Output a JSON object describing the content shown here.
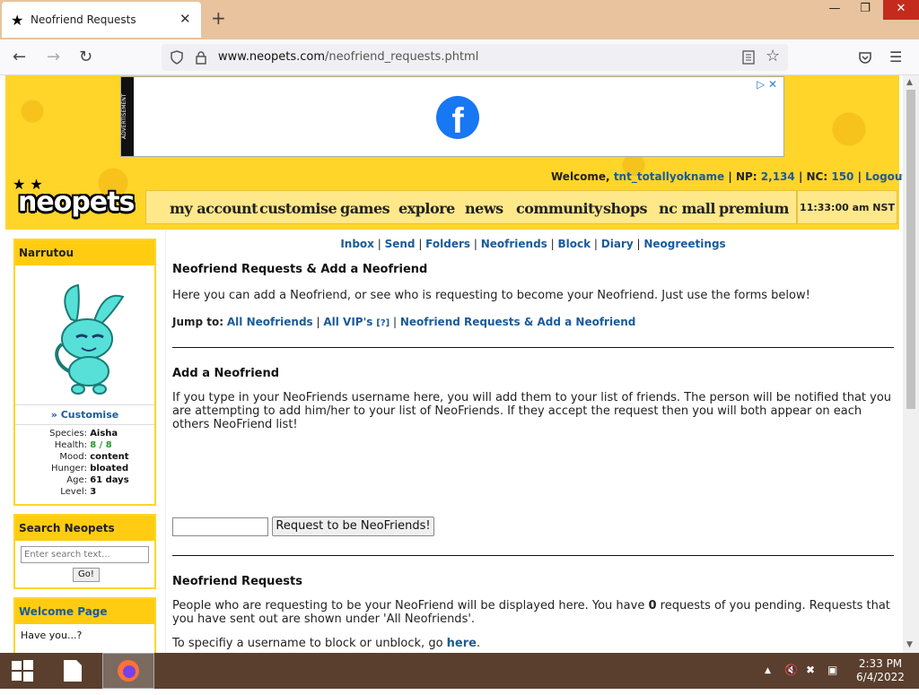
{
  "browser": {
    "tab_title": "Neofriend Requests",
    "tab_icon": "★",
    "close_glyph": "✕",
    "newtab_glyph": "+",
    "url_domain": "www.neopets.com",
    "url_path": "/neofriend_requests.phtml",
    "min_glyph": "—",
    "restore_glyph": "❐",
    "win_close_glyph": "✕"
  },
  "header": {
    "ad_label": "ADVERTISEMENT",
    "ad_logo": "f",
    "ad_close": "▷ ✕",
    "welcome_label": "Welcome,",
    "username": "tnt_totallyokname",
    "np_label": "| NP:",
    "np_value": "2,134",
    "nc_label": "| NC:",
    "nc_value": "150",
    "logout": "Logout",
    "logo_text": "neopets",
    "logo_stars": "★ ★",
    "clock": "11:33:00 am NST",
    "menu": [
      "my account",
      "customise",
      "games",
      "explore",
      "news",
      "community",
      "shops",
      "nc mall",
      "premium"
    ]
  },
  "pet": {
    "name": "Narrutou",
    "customise": "» Customise",
    "stats": [
      {
        "k": "Species:",
        "v": "Aisha"
      },
      {
        "k": "Health:",
        "v": "8 / 8"
      },
      {
        "k": "Mood:",
        "v": "content"
      },
      {
        "k": "Hunger:",
        "v": "bloated"
      },
      {
        "k": "Age:",
        "v": "61 days"
      },
      {
        "k": "Level:",
        "v": "3"
      }
    ]
  },
  "search": {
    "title": "Search Neopets",
    "placeholder": "Enter search text...",
    "go": "Go!"
  },
  "welcome_panel": {
    "title": "Welcome Page",
    "text": "Have you...?"
  },
  "main": {
    "mail_links": [
      "Inbox",
      "Send",
      "Folders",
      "Neofriends",
      "Block",
      "Diary",
      "Neogreetings"
    ],
    "title": "Neofriend Requests & Add a Neofriend",
    "intro": "Here you can add a Neofriend, or see who is requesting to become your Neofriend. Just use the forms below!",
    "jump_label": "Jump to:",
    "jump_links": [
      "All Neofriends",
      "All VIP's",
      "Neofriend Requests & Add a Neofriend"
    ],
    "vip_help": "[?]",
    "add_title": "Add a Neofriend",
    "add_text": "If you type in your NeoFriends username here, you will add them to your list of friends. The person will be notified that you are attempting to add him/her to your list of NeoFriends. If they accept the request then you will both appear on each others NeoFriend list!",
    "request_button": "Request to be NeoFriends!",
    "requests_title": "Neofriend Requests",
    "requests_text_1": "People who are requesting to be your NeoFriend will be displayed here. You have",
    "requests_count": "0",
    "requests_text_2": "requests of you pending. Requests that you have sent out are shown under 'All Neofriends'.",
    "block_text": "To specifiy a username to block or unblock, go",
    "block_link": "here",
    "block_end": "."
  },
  "taskbar": {
    "time": "2:33 PM",
    "date": "6/4/2022",
    "tray_arrow": "▲"
  },
  "colors": {
    "header_yellow": "#ffd52a",
    "link_blue": "#1a5b9a",
    "taskbar": "#5a3f2e"
  }
}
